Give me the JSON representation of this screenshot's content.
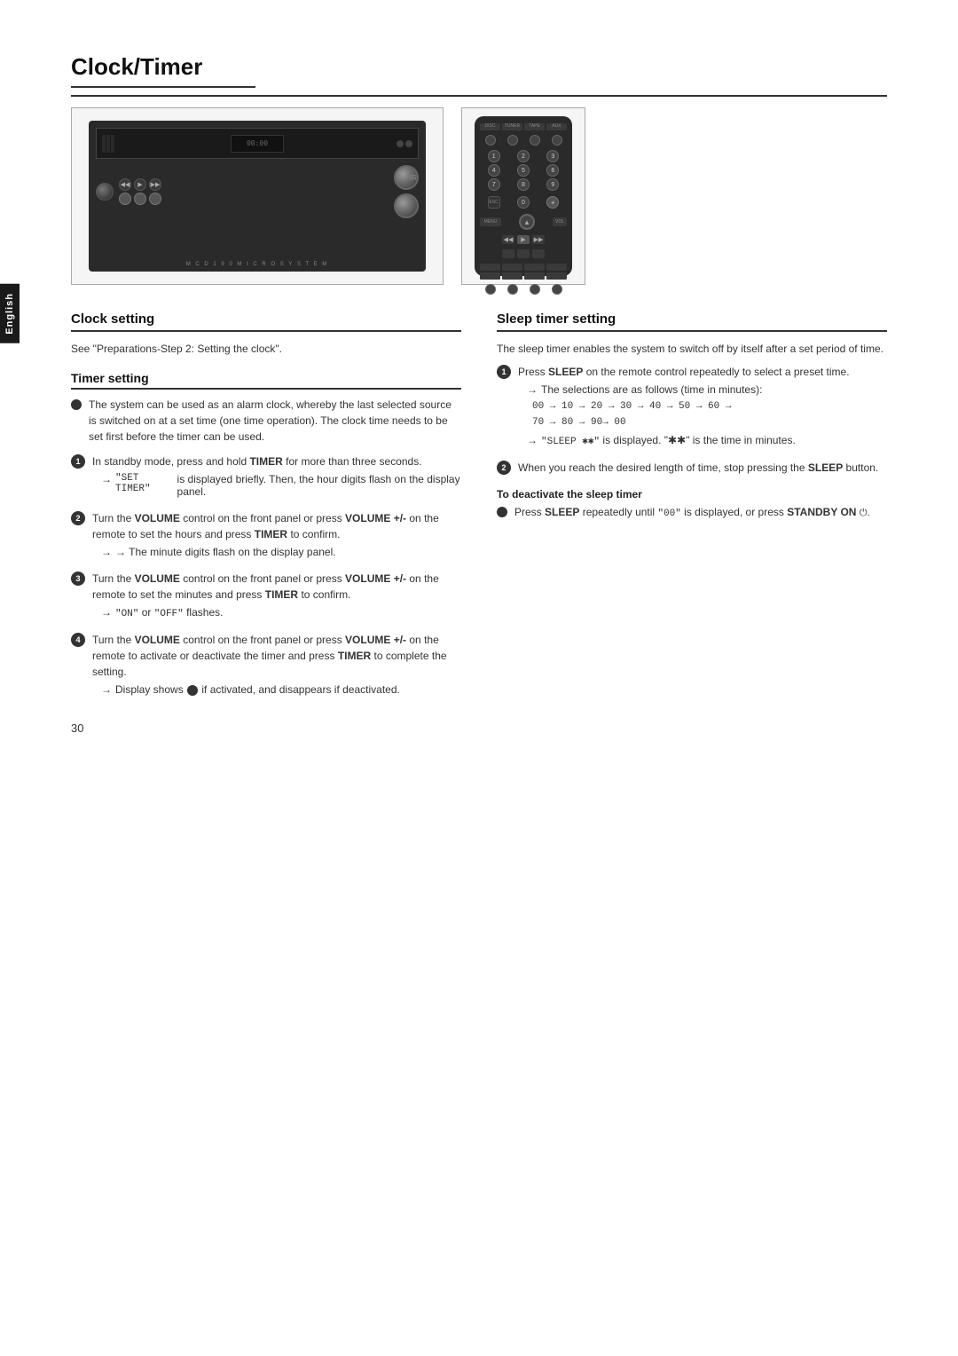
{
  "page": {
    "title": "Clock/Timer",
    "page_number": "30",
    "language_tab": "English"
  },
  "clock_setting": {
    "title": "Clock setting",
    "body": "See \"Preparations-Step 2: Setting the clock\"."
  },
  "timer_setting": {
    "title": "Timer setting",
    "bullet_1": "The system can be used as an alarm clock, whereby the last selected source is switched on at a set time (one time operation). The clock time needs to be set first before the timer can be used.",
    "step_1_text": "In standby mode, press and hold ",
    "step_1_bold": "TIMER",
    "step_1_rest": " for more than three seconds.",
    "step_1_arrow": "→ \"SET TIMER\" is displayed briefly. Then, the hour digits flash on the display panel.",
    "step_2_text": "Turn the ",
    "step_2_bold1": "VOLUME",
    "step_2_mid": " control on the front panel or press ",
    "step_2_bold2": "VOLUME +/-",
    "step_2_rest": " on the remote to set the hours and press ",
    "step_2_bold3": "TIMER",
    "step_2_end": " to confirm.",
    "step_2_arrow": "→ The minute digits flash on the display panel.",
    "step_3_text": "Turn the ",
    "step_3_bold1": "VOLUME",
    "step_3_mid": " control on the front panel or press ",
    "step_3_bold2": "VOLUME +/-",
    "step_3_rest": " on the remote to set the minutes and press ",
    "step_3_bold3": "TIMER",
    "step_3_end": " to confirm.",
    "step_3_arrow": "→ \"ON\" or \"OFF\" flashes.",
    "step_4_text": "Turn the ",
    "step_4_bold1": "VOLUME",
    "step_4_mid": " control on the front panel or press ",
    "step_4_bold2": "VOLUME +/-",
    "step_4_rest": " on the remote to activate or deactivate the timer and press ",
    "step_4_bold3": "TIMER",
    "step_4_end": " to complete the setting.",
    "step_4_arrow": "→ Display shows  if activated, and disappears if deactivated."
  },
  "sleep_timer": {
    "title": "Sleep timer setting",
    "intro": "The sleep timer enables the system to switch off by itself after a set period of time.",
    "step_1_text": "Press ",
    "step_1_bold": "SLEEP",
    "step_1_rest": " on the remote control repeatedly to select a preset time.",
    "step_1_arrow1": "→ The selections are as follows (time in minutes):",
    "step_1_sequence": "00 → 10 → 20 → 30 → 40 → 50 → 60 → 70 → 80 → 90→ 00",
    "step_1_arrow2": "→ \"SLEEP ✱✱\" is displayed. \"✱✱\" is the time in minutes.",
    "step_2_text": "When you reach the desired length of time, stop pressing the ",
    "step_2_bold": "SLEEP",
    "step_2_end": " button.",
    "deactivate_title": "To deactivate the sleep timer",
    "deactivate_bullet": "Press ",
    "deactivate_bold1": "SLEEP",
    "deactivate_mid": " repeatedly until \"00\" is displayed, or press ",
    "deactivate_bold2": "STANDBY ON",
    "deactivate_icon": "⏻",
    "deactivate_end": "."
  }
}
